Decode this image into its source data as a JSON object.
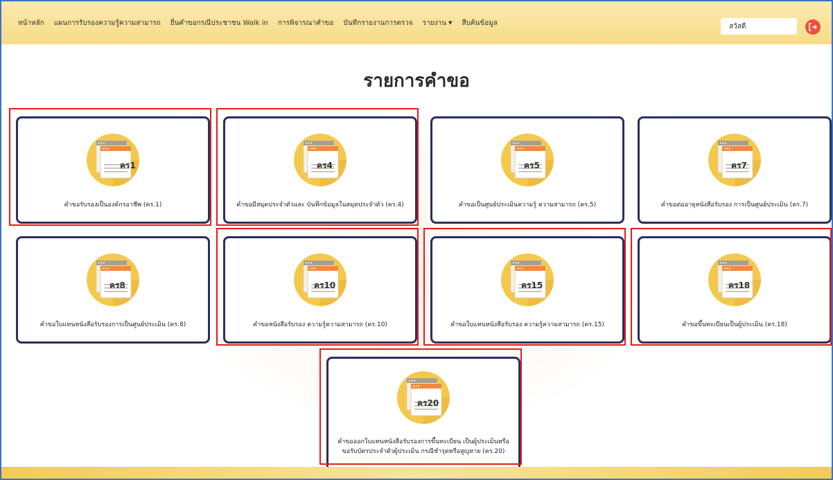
{
  "nav": {
    "items": [
      {
        "label": "หน้าหลัก"
      },
      {
        "label": "แผนการรับรองความรู้ความสามารถ"
      },
      {
        "label": "ยื่นคำขอกรณีประชาชน Walk in"
      },
      {
        "label": "การพิจารณาคำขอ"
      },
      {
        "label": "บันทึกรายงานการตรวจ"
      },
      {
        "label": "รายงาน",
        "dropdown": true
      },
      {
        "label": "สืบค้นข้อมูล"
      }
    ],
    "greeting": "สวัสดี",
    "logout_icon": "logout-icon"
  },
  "page": {
    "title": "รายการคำขอ"
  },
  "cards": [
    {
      "code": "คร1",
      "label": "คำขอรับรองเป็นองค์กรอาชีพ (คร.1)"
    },
    {
      "code": "คร4",
      "label": "คำขอมีสมุดประจำตัวและ บันทึกข้อมูลในสมุดประจำตัว (คร.4)"
    },
    {
      "code": "คร5",
      "label": "คำขอเป็นศูนย์ประเมินความรู้ ความสามารถ (คร.5)"
    },
    {
      "code": "คร7",
      "label": "คำขอต่ออายุหนังสือรับรอง การเป็นศูนย์ประเมิน (คร.7)"
    },
    {
      "code": "คร8",
      "label": "คำขอใบแทนหนังสือรับรองการเป็นศูนย์ประเมิน (คร.8)"
    },
    {
      "code": "คร10",
      "label": "คำขอหนังสือรับรอง ความรู้ความสามารถ (คร.10)"
    },
    {
      "code": "คร15",
      "label": "คำขอใบแทนหนังสือรับรอง ความรู้ความสามารถ (คร.15)"
    },
    {
      "code": "คร18",
      "label": "คำขอขึ้นทะเบียนเป็นผู้ประเมิน (คร.18)"
    },
    {
      "code": "คร20",
      "label": "คำขอออกใบแทนหนังสือรับรองการขึ้นทะเบียน เป็นผู้ประเมินหรือ ขอรับบัตรประจำตัวผู้ประเมิน กรณีชำรุดหรือสูญหาย (คร.20)"
    }
  ],
  "colors": {
    "accent": "#f3c84e",
    "card_border": "#2a2f5c",
    "highlight": "#e51b1b",
    "logout": "#f14e3c"
  }
}
